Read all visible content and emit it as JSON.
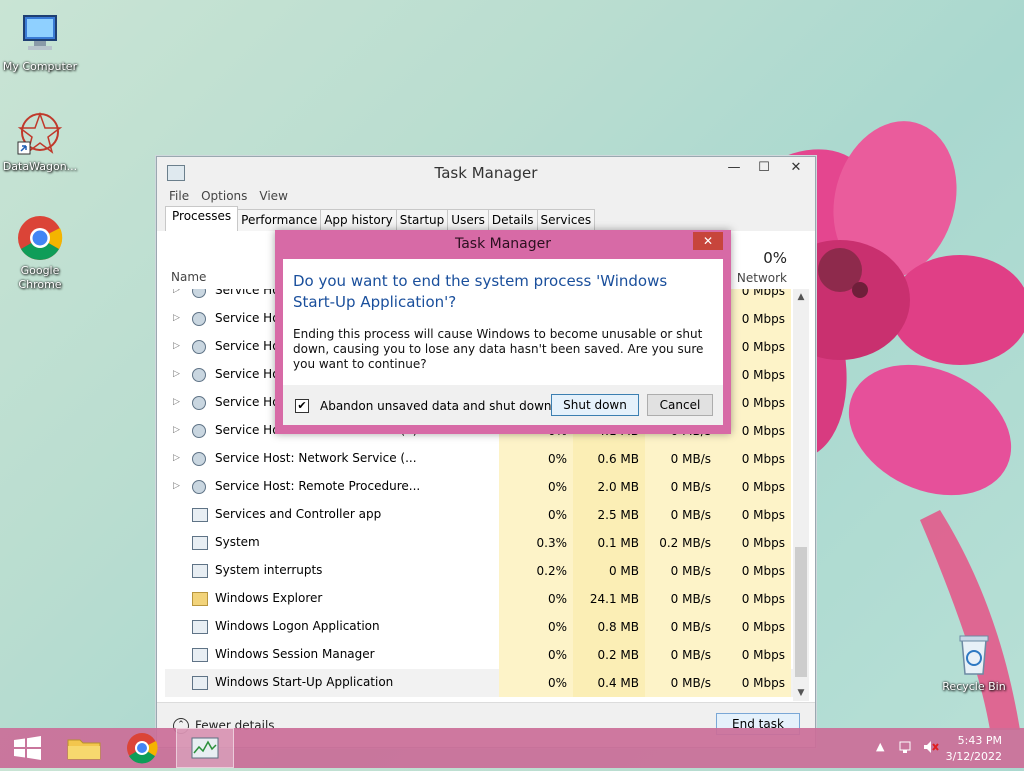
{
  "desktop": {
    "icons": [
      {
        "label": "My Computer"
      },
      {
        "label": "DataWagon..."
      },
      {
        "label": "Google Chrome"
      },
      {
        "label": "Recycle Bin"
      }
    ]
  },
  "task_manager": {
    "title": "Task Manager",
    "menu": [
      "File",
      "Options",
      "View"
    ],
    "tabs": [
      "Processes",
      "Performance",
      "App history",
      "Startup",
      "Users",
      "Details",
      "Services"
    ],
    "active_tab": "Processes",
    "columns": {
      "name": "Name",
      "network_pct": "0%",
      "network": "Network"
    },
    "rows": [
      {
        "name": "Service Host",
        "expandable": true,
        "icon": "gear-icon",
        "cpu": "",
        "mem": "",
        "disk": "",
        "net": "0 Mbps"
      },
      {
        "name": "Service Host",
        "expandable": true,
        "icon": "gear-icon",
        "cpu": "",
        "mem": "",
        "disk": "",
        "net": "0 Mbps"
      },
      {
        "name": "Service Host",
        "expandable": true,
        "icon": "gear-icon",
        "cpu": "",
        "mem": "",
        "disk": "",
        "net": "0 Mbps"
      },
      {
        "name": "Service Host",
        "expandable": true,
        "icon": "gear-icon",
        "cpu": "",
        "mem": "",
        "disk": "",
        "net": "0 Mbps"
      },
      {
        "name": "Service Host",
        "expandable": true,
        "icon": "gear-icon",
        "cpu": "",
        "mem": "",
        "disk": "",
        "net": "0 Mbps"
      },
      {
        "name": "Service Host: Network Service (4)",
        "expandable": true,
        "icon": "gear-icon",
        "cpu": "0%",
        "mem": "4.1 MB",
        "disk": "0 MB/s",
        "net": "0 Mbps"
      },
      {
        "name": "Service Host: Network Service (...",
        "expandable": true,
        "icon": "gear-icon",
        "cpu": "0%",
        "mem": "0.6 MB",
        "disk": "0 MB/s",
        "net": "0 Mbps"
      },
      {
        "name": "Service Host: Remote Procedure...",
        "expandable": true,
        "icon": "gear-icon",
        "cpu": "0%",
        "mem": "2.0 MB",
        "disk": "0 MB/s",
        "net": "0 Mbps"
      },
      {
        "name": "Services and Controller app",
        "expandable": false,
        "icon": "app-icon",
        "cpu": "0%",
        "mem": "2.5 MB",
        "disk": "0 MB/s",
        "net": "0 Mbps"
      },
      {
        "name": "System",
        "expandable": false,
        "icon": "app-icon",
        "cpu": "0.3%",
        "mem": "0.1 MB",
        "disk": "0.2 MB/s",
        "net": "0 Mbps"
      },
      {
        "name": "System interrupts",
        "expandable": false,
        "icon": "app-icon",
        "cpu": "0.2%",
        "mem": "0 MB",
        "disk": "0 MB/s",
        "net": "0 Mbps"
      },
      {
        "name": "Windows Explorer",
        "expandable": false,
        "icon": "folder-icon",
        "cpu": "0%",
        "mem": "24.1 MB",
        "disk": "0 MB/s",
        "net": "0 Mbps"
      },
      {
        "name": "Windows Logon Application",
        "expandable": false,
        "icon": "app-icon",
        "cpu": "0%",
        "mem": "0.8 MB",
        "disk": "0 MB/s",
        "net": "0 Mbps"
      },
      {
        "name": "Windows Session Manager",
        "expandable": false,
        "icon": "app-icon",
        "cpu": "0%",
        "mem": "0.2 MB",
        "disk": "0 MB/s",
        "net": "0 Mbps"
      },
      {
        "name": "Windows Start-Up Application",
        "expandable": false,
        "icon": "app-icon",
        "cpu": "0%",
        "mem": "0.4 MB",
        "disk": "0 MB/s",
        "net": "0 Mbps",
        "selected": true
      }
    ],
    "footer": {
      "fewer_details": "Fewer details",
      "end_task": "End task"
    }
  },
  "dialog": {
    "title": "Task Manager",
    "close": "✕",
    "question": "Do you want to end the system process 'Windows Start-Up Application'?",
    "message": "Ending this process will cause Windows to become unusable or shut down, causing you to lose any data hasn't been saved. Are you sure you want to continue?",
    "checkbox_label": "Abandon unsaved data and shut down.",
    "checkbox_checked": true,
    "shutdown_label": "Shut down",
    "cancel_label": "Cancel"
  },
  "taskbar": {
    "time": "5:43 PM",
    "date": "3/12/2022",
    "tray_arrow": "▲"
  },
  "colors": {
    "dialog_frame": "#d76aa6",
    "taskbar": "#cb6e98",
    "question_text": "#1a4f9c",
    "cpu_highlight": "#fdf3c8",
    "mem_highlight": "#fbeeb5"
  }
}
